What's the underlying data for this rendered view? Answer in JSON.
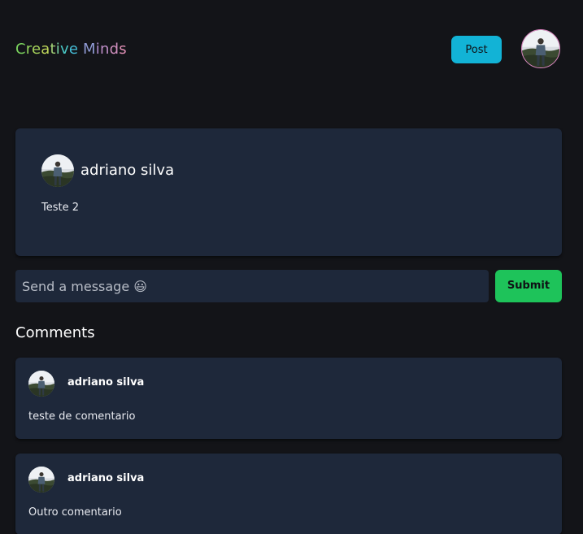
{
  "header": {
    "logo_text": "Creative Minds",
    "post_button_label": "Post",
    "user_avatar_icon": "user-avatar-photo"
  },
  "colors": {
    "background": "#131418",
    "card": "#1e283a",
    "post_button": "#12b3d6",
    "submit_button": "#1ec35a",
    "logo_gradient": [
      "#79d15d",
      "#c4d65a",
      "#33c6d8",
      "#a98bd0",
      "#e08fb5"
    ]
  },
  "post": {
    "author_name": "adriano silva",
    "content": "Teste 2"
  },
  "message_form": {
    "input_value": "",
    "placeholder": "Send a message 😃",
    "submit_label": "Submit"
  },
  "comments": {
    "heading": "Comments",
    "items": [
      {
        "author_name": "adriano silva",
        "content": "teste de comentario"
      },
      {
        "author_name": "adriano silva",
        "content": "Outro comentario"
      }
    ]
  }
}
